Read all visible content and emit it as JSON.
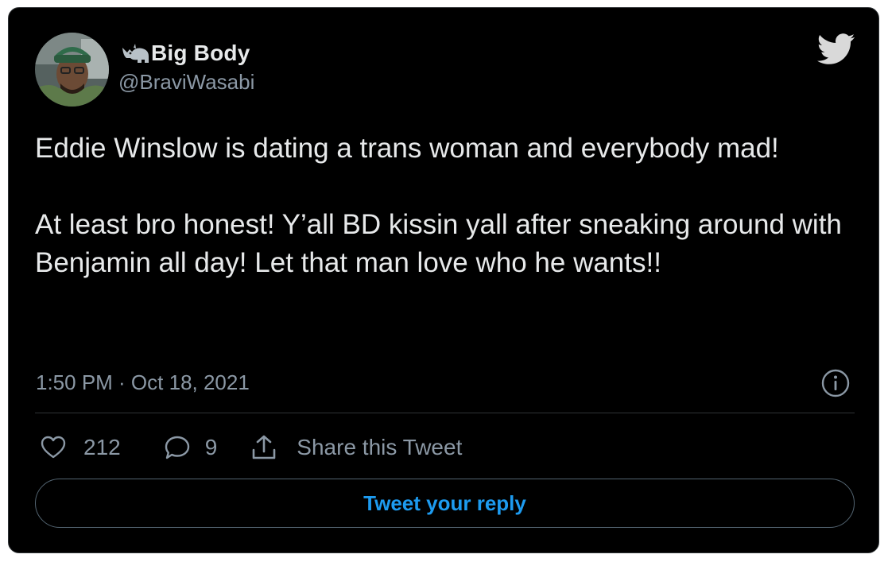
{
  "author": {
    "display_name": "Big Body",
    "handle": "@BraviWasabi",
    "name_emoji": "rhinoceros-emoji",
    "avatar": "user-avatar-photo"
  },
  "tweet": {
    "text": "Eddie Winslow is dating a trans woman and everybody mad!\n\nAt least bro honest! Y’all BD kissin yall after sneaking around with Benjamin all day! Let that man love who he wants!!",
    "timestamp": "1:50 PM · Oct 18, 2021"
  },
  "actions": {
    "like_count": "212",
    "reply_count": "9",
    "share_label": "Share this Tweet"
  },
  "reply_button": {
    "label": "Tweet your reply"
  },
  "icons": {
    "brand": "twitter-bird-icon",
    "info": "info-icon",
    "like": "heart-icon",
    "reply": "speech-bubble-icon",
    "share": "share-upload-icon"
  },
  "colors": {
    "background": "#000000",
    "text": "#e7e9ea",
    "secondary_text": "#8b98a5",
    "accent": "#1d9bf0",
    "border": "#2f3336"
  }
}
